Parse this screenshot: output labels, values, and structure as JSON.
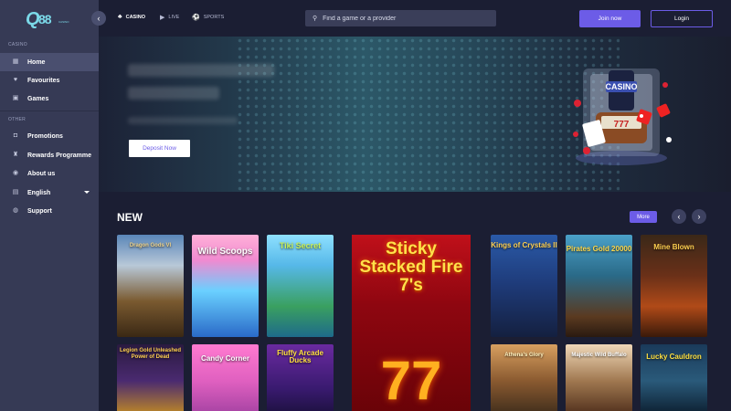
{
  "brand": {
    "logo_q": "Q",
    "logo_num": "88",
    "logo_sub": "CASINO"
  },
  "sidebar": {
    "section_casino": "CASINO",
    "section_other": "OTHER",
    "items": [
      {
        "label": "Home",
        "icon": "grid-icon"
      },
      {
        "label": "Favourites",
        "icon": "heart-icon"
      },
      {
        "label": "Games",
        "icon": "slot-icon"
      },
      {
        "label": "Promotions",
        "icon": "gift-icon"
      },
      {
        "label": "Rewards Programme",
        "icon": "trophy-icon"
      },
      {
        "label": "About us",
        "icon": "info-icon"
      },
      {
        "label": "English",
        "icon": "flag-icon"
      },
      {
        "label": "Support",
        "icon": "chat-icon"
      }
    ]
  },
  "topnav": {
    "casino": "CASINO",
    "live": "LIVE",
    "sports": "SPORTS"
  },
  "search": {
    "placeholder": "Find a game or a provider"
  },
  "auth": {
    "join": "Join now",
    "login": "Login"
  },
  "banner": {
    "cta": "Deposit Now",
    "art_sign": "CASINO"
  },
  "new_section": {
    "title": "NEW",
    "more": "More",
    "games": [
      {
        "title": "Dragon Gods VI"
      },
      {
        "title": "Wild Scoops"
      },
      {
        "title": "Tiki Secret"
      },
      {
        "title": "Sticky Stacked Fire 7's"
      },
      {
        "title": "Kings of Crystals II"
      },
      {
        "title": "Pirates Gold 20000"
      },
      {
        "title": "Mine Blown"
      },
      {
        "title": "Legion Gold Unleashed Power of Dead"
      },
      {
        "title": "Candy Corner"
      },
      {
        "title": "Fluffy Arcade Ducks"
      },
      {
        "title": "Athena's Glory"
      },
      {
        "title": "Majestic Wild Buffalo"
      },
      {
        "title": "Lucky Cauldron"
      }
    ]
  },
  "colors": {
    "accent": "#6c5ce7",
    "sidebar": "#363a55",
    "background": "#1b1e33"
  }
}
